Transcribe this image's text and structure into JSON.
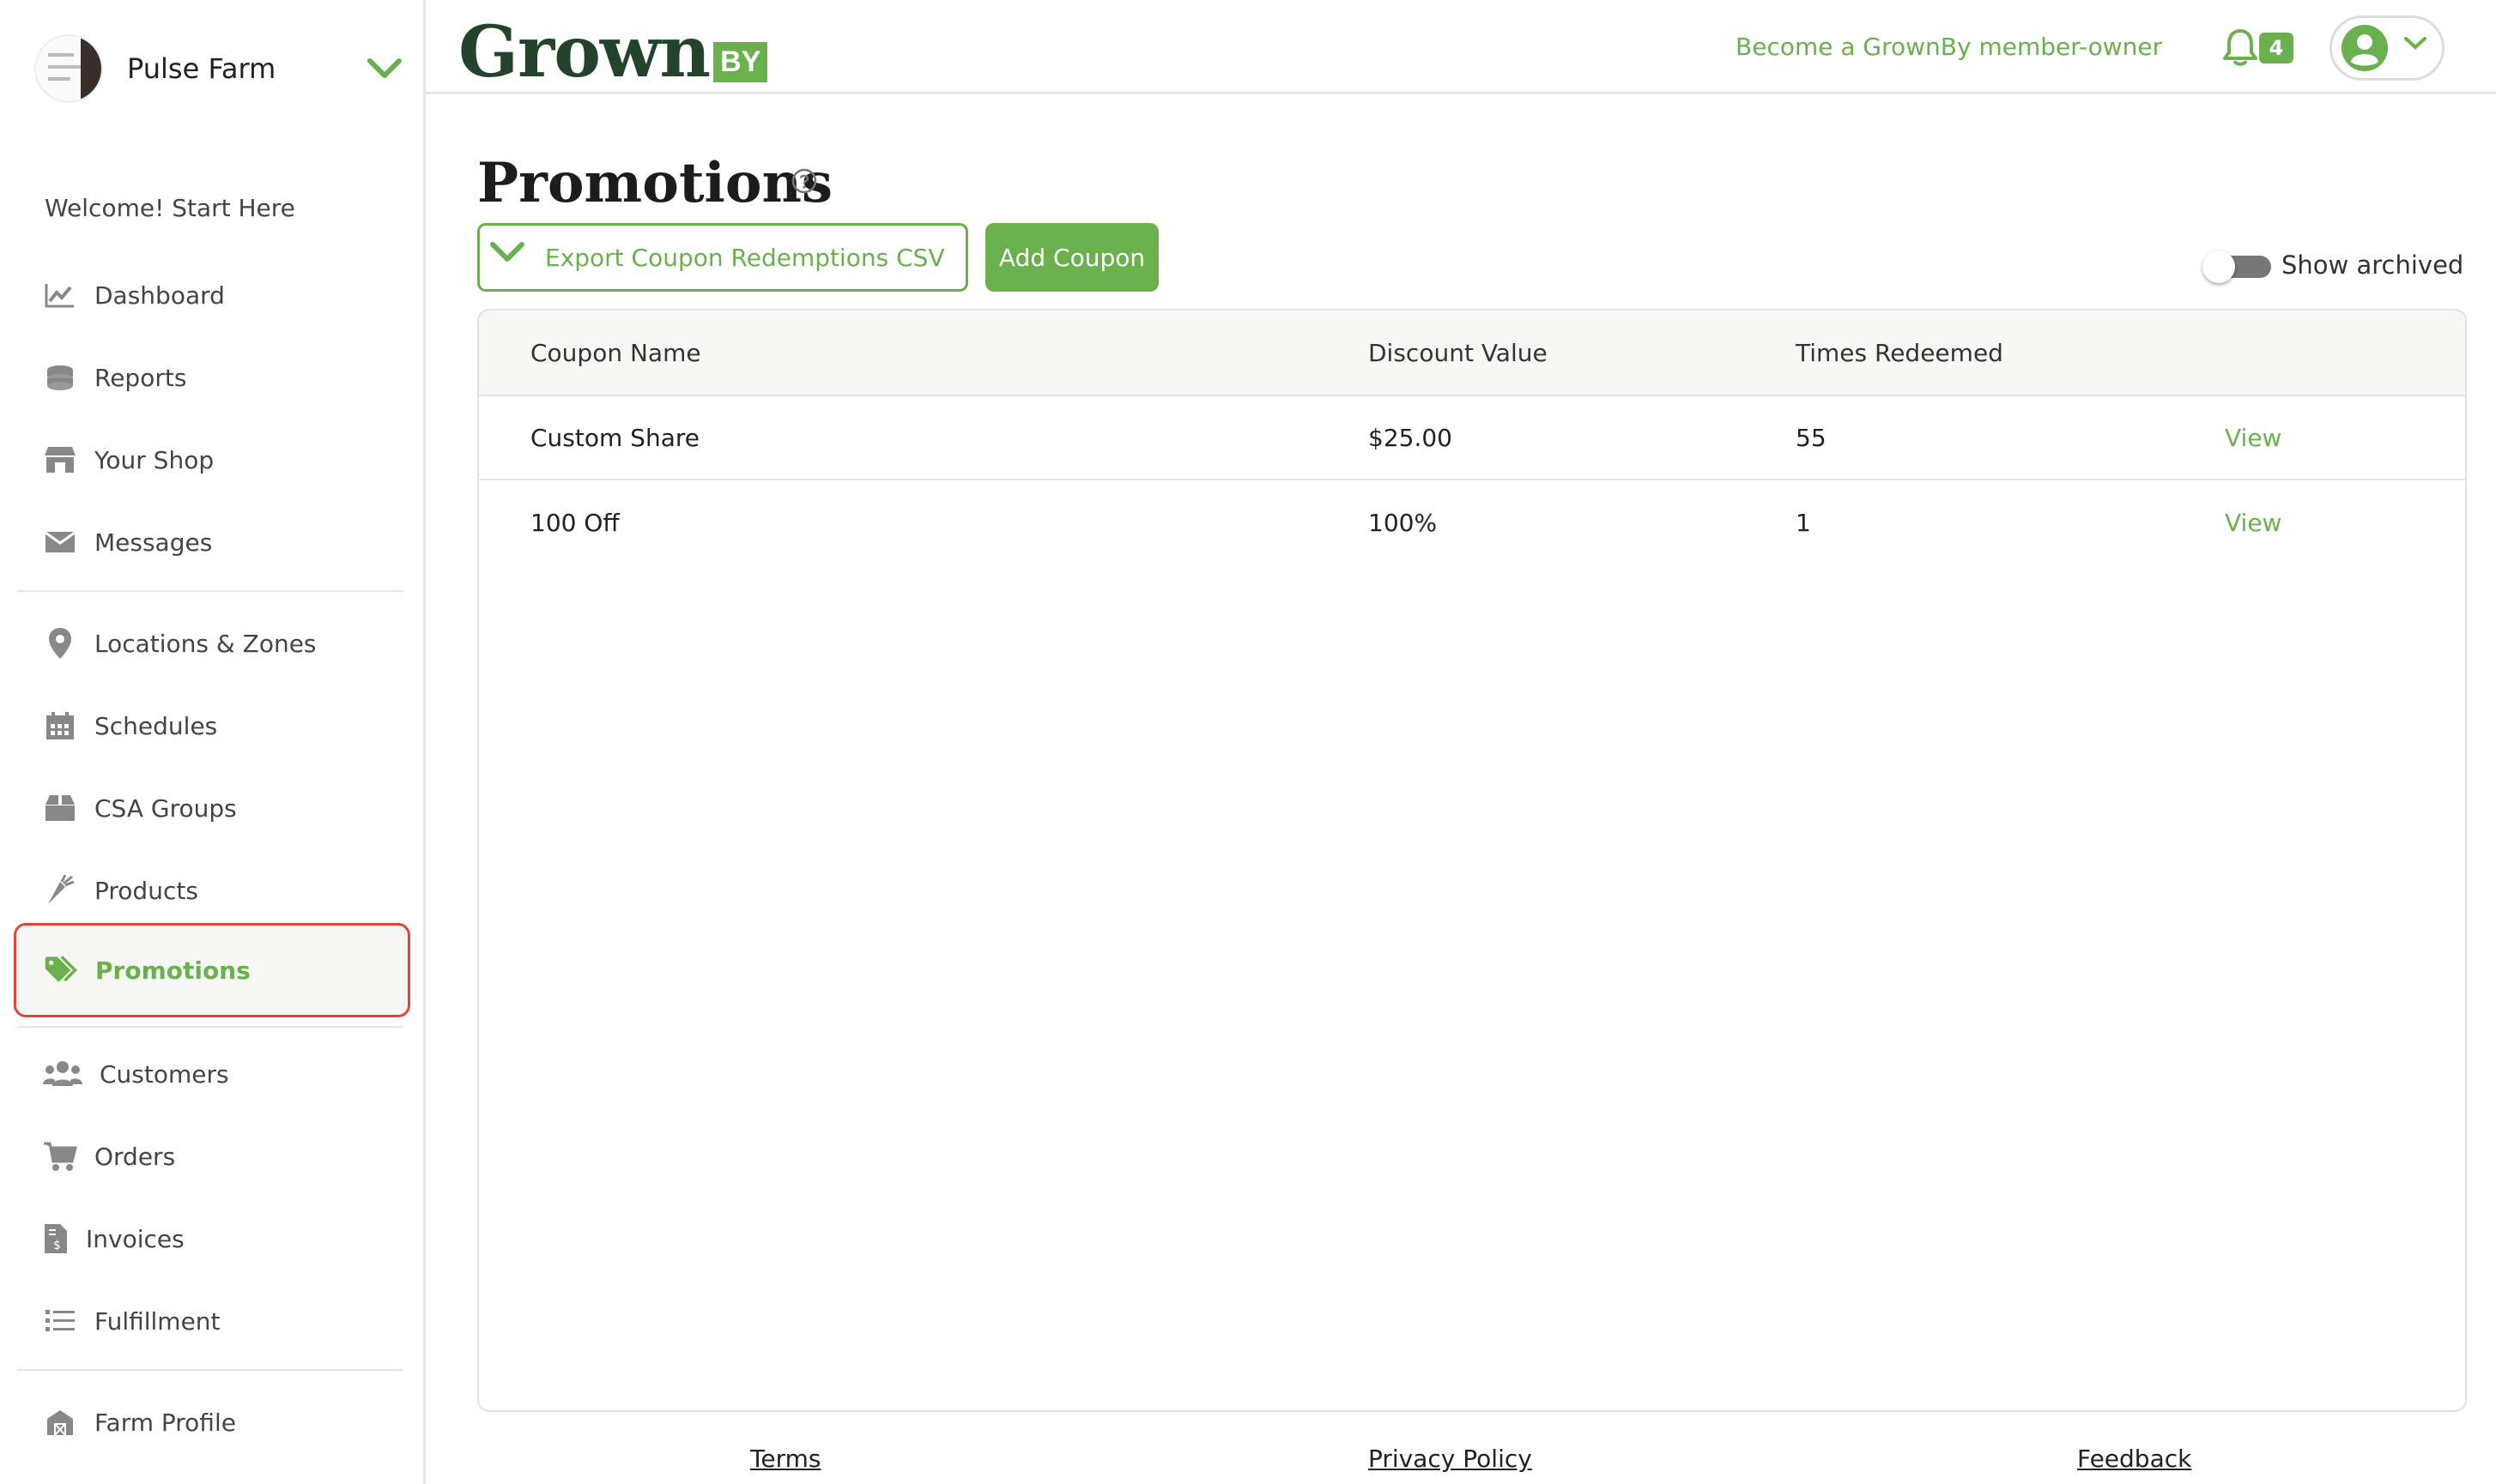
{
  "farm": {
    "name": "Pulse Farm"
  },
  "sidebar": {
    "welcome": "Welcome! Start Here",
    "items": [
      {
        "label": "Dashboard",
        "icon": "chart-icon"
      },
      {
        "label": "Reports",
        "icon": "coins-icon"
      },
      {
        "label": "Your Shop",
        "icon": "store-icon"
      },
      {
        "label": "Messages",
        "icon": "envelope-icon"
      },
      {
        "label": "Locations & Zones",
        "icon": "map-pin-icon"
      },
      {
        "label": "Schedules",
        "icon": "calendar-icon"
      },
      {
        "label": "CSA Groups",
        "icon": "box-icon"
      },
      {
        "label": "Products",
        "icon": "carrot-icon"
      },
      {
        "label": "Promotions",
        "icon": "tags-icon",
        "active": true
      },
      {
        "label": "Customers",
        "icon": "users-icon"
      },
      {
        "label": "Orders",
        "icon": "cart-icon"
      },
      {
        "label": "Invoices",
        "icon": "invoice-icon"
      },
      {
        "label": "Fulfillment",
        "icon": "list-icon"
      },
      {
        "label": "Farm Profile",
        "icon": "barn-icon"
      }
    ]
  },
  "header": {
    "logo_text": "Grown",
    "logo_badge": "BY",
    "member_link": "Become a GrownBy member-owner",
    "notification_count": "4"
  },
  "main": {
    "title": "Promotions",
    "export_label": "Export Coupon Redemptions CSV",
    "add_label": "Add Coupon",
    "show_archived_label": "Show archived",
    "show_archived": false,
    "table": {
      "headers": [
        "Coupon Name",
        "Discount Value",
        "Times Redeemed"
      ],
      "rows": [
        {
          "name": "Custom Share",
          "discount": "$25.00",
          "redeemed": "55",
          "action": "View"
        },
        {
          "name": "100 Off",
          "discount": "100%",
          "redeemed": "1",
          "action": "View"
        }
      ]
    }
  },
  "footer": {
    "terms": "Terms",
    "privacy": "Privacy Policy",
    "feedback": "Feedback"
  },
  "colors": {
    "accent": "#6ab04c",
    "logo_dark": "#23432b",
    "highlight_border": "#e0453a"
  }
}
